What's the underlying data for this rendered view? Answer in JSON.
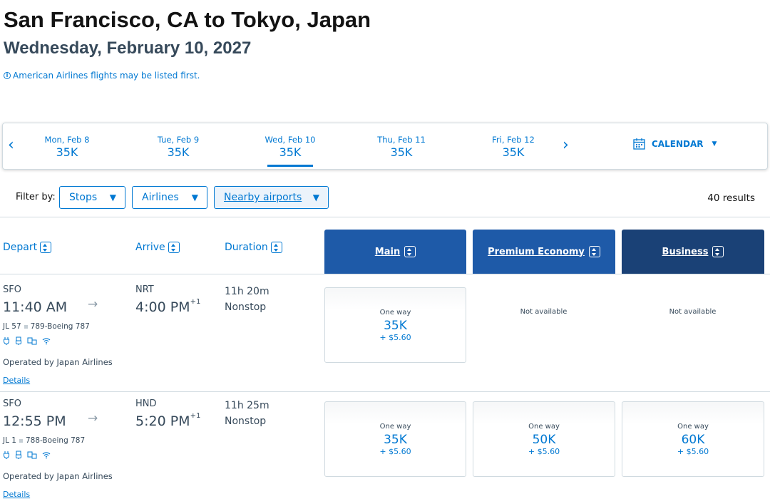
{
  "header": {
    "title": "San Francisco, CA to Tokyo, Japan",
    "date": "Wednesday, February 10, 2027",
    "notice": "American Airlines flights may be listed first."
  },
  "date_bar": {
    "dates": [
      {
        "day": "Mon, Feb 8",
        "price": "35K"
      },
      {
        "day": "Tue, Feb 9",
        "price": "35K"
      },
      {
        "day": "Wed, Feb 10",
        "price": "35K",
        "selected": true
      },
      {
        "day": "Thu, Feb 11",
        "price": "35K"
      },
      {
        "day": "Fri, Feb 12",
        "price": "35K"
      }
    ],
    "prev_icon": "‹",
    "next_icon": "›",
    "calendar_label": "CALENDAR"
  },
  "filters": {
    "label": "Filter by:",
    "stops": "Stops",
    "airlines": "Airlines",
    "nearby": "Nearby airports",
    "results": "40 results"
  },
  "columns": {
    "depart": "Depart",
    "arrive": "Arrive",
    "duration": "Duration",
    "main": "Main",
    "premium": "Premium Economy",
    "business": "Business"
  },
  "colors": {
    "accent": "#0078d2",
    "main_header": "#1e5aa8",
    "premium_header": "#1e5aa8",
    "business_header": "#1a4176"
  },
  "flights": [
    {
      "origin": "SFO",
      "depart_time": "11:40 AM",
      "dest": "NRT",
      "arrive_time": "4:00 PM",
      "day_offset": "+1",
      "flight_number": "JL 57",
      "aircraft": "789-Boeing 787",
      "duration": "11h 20m",
      "stops": "Nonstop",
      "operated": "Operated by Japan Airlines",
      "details": "Details",
      "fares": {
        "main": {
          "label": "One way",
          "price": "35K",
          "fee": "+ $5.60"
        },
        "premium": {
          "na": "Not available"
        },
        "business": {
          "na": "Not available"
        }
      }
    },
    {
      "origin": "SFO",
      "depart_time": "12:55 PM",
      "dest": "HND",
      "arrive_time": "5:20 PM",
      "day_offset": "+1",
      "flight_number": "JL 1",
      "aircraft": "788-Boeing 787",
      "duration": "11h 25m",
      "stops": "Nonstop",
      "operated": "Operated by Japan Airlines",
      "details": "Details",
      "fares": {
        "main": {
          "label": "One way",
          "price": "35K",
          "fee": "+ $5.60"
        },
        "premium": {
          "label": "One way",
          "price": "50K",
          "fee": "+ $5.60"
        },
        "business": {
          "label": "One way",
          "price": "60K",
          "fee": "+ $5.60"
        }
      }
    }
  ]
}
